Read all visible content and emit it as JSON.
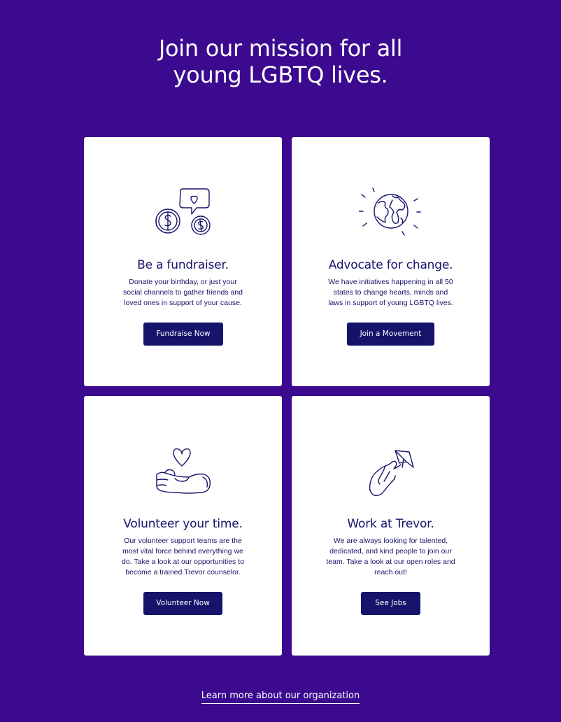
{
  "header": {
    "title_line1": "Join our mission for all",
    "title_line2": "young LGBTQ lives."
  },
  "cards": [
    {
      "title": "Be a fundraiser.",
      "description": "Donate your birthday, or just your social channels to gather friends and loved ones in support of your cause.",
      "button_label": "Fundraise Now",
      "icon": "coins-with-heart-bubble-icon"
    },
    {
      "title": "Advocate for change.",
      "description": "We have initiatives happening in all 50 states to change hearts, minds and laws in support of young LGBTQ lives.",
      "button_label": "Join a Movement",
      "icon": "globe-icon"
    },
    {
      "title": "Volunteer your time.",
      "description": "Our volunteer support teams are the most vital force behind everything we do. Take a look at our opportunities to become a trained Trevor counselor.",
      "button_label": "Volunteer Now",
      "icon": "hand-holding-heart-icon"
    },
    {
      "title": "Work at Trevor.",
      "description": "We are always looking for talented, dedicated, and kind people to join our team. Take a look at our open roles  and reach out!",
      "button_label": "See Jobs",
      "icon": "hand-with-paper-plane-icon"
    }
  ],
  "footer": {
    "link_label": "Learn more about our organization"
  },
  "colors": {
    "background": "#3b0a8f",
    "navy": "#15136a",
    "card": "#ffffff"
  }
}
